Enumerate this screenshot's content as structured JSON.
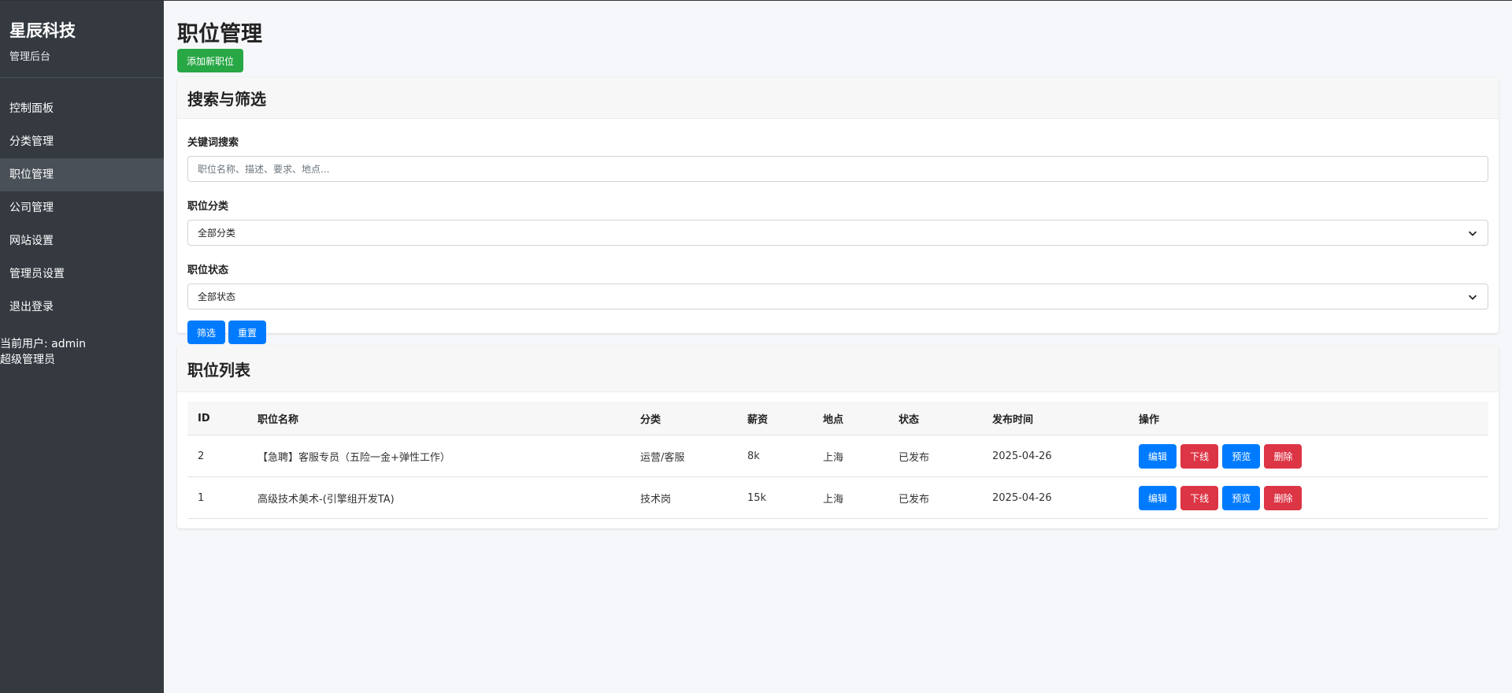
{
  "sidebar": {
    "brand_title": "星辰科技",
    "brand_sub": "管理后台",
    "items": [
      {
        "label": "控制面板"
      },
      {
        "label": "分类管理"
      },
      {
        "label": "职位管理",
        "active": true
      },
      {
        "label": "公司管理"
      },
      {
        "label": "网站设置"
      },
      {
        "label": "管理员设置"
      },
      {
        "label": "退出登录"
      }
    ],
    "current_user": "当前用户: admin",
    "role": "超级管理员"
  },
  "page": {
    "title": "职位管理",
    "add_button": "添加新职位"
  },
  "search": {
    "header": "搜索与筛选",
    "keyword_label": "关键词搜索",
    "keyword_placeholder": "职位名称、描述、要求、地点...",
    "category_label": "职位分类",
    "category_selected": "全部分类",
    "status_label": "职位状态",
    "status_selected": "全部状态",
    "filter_button": "筛选",
    "reset_button": "重置"
  },
  "list": {
    "header": "职位列表",
    "columns": [
      "ID",
      "职位名称",
      "分类",
      "薪资",
      "地点",
      "状态",
      "发布时间",
      "操作"
    ],
    "rows": [
      {
        "id": "2",
        "name": "【急聘】客服专员（五险一金+弹性工作）",
        "category": "运营/客服",
        "salary": "8k",
        "location": "上海",
        "status": "已发布",
        "date": "2025-04-26"
      },
      {
        "id": "1",
        "name": "高级技术美术-(引擎组开发TA)",
        "category": "技术岗",
        "salary": "15k",
        "location": "上海",
        "status": "已发布",
        "date": "2025-04-26"
      }
    ],
    "actions": {
      "edit": "编辑",
      "offline": "下线",
      "preview": "预览",
      "delete": "删除"
    }
  },
  "colors": {
    "sidebar": "#343a40",
    "primary": "#007bff",
    "success": "#28a745",
    "danger": "#dc3545"
  }
}
